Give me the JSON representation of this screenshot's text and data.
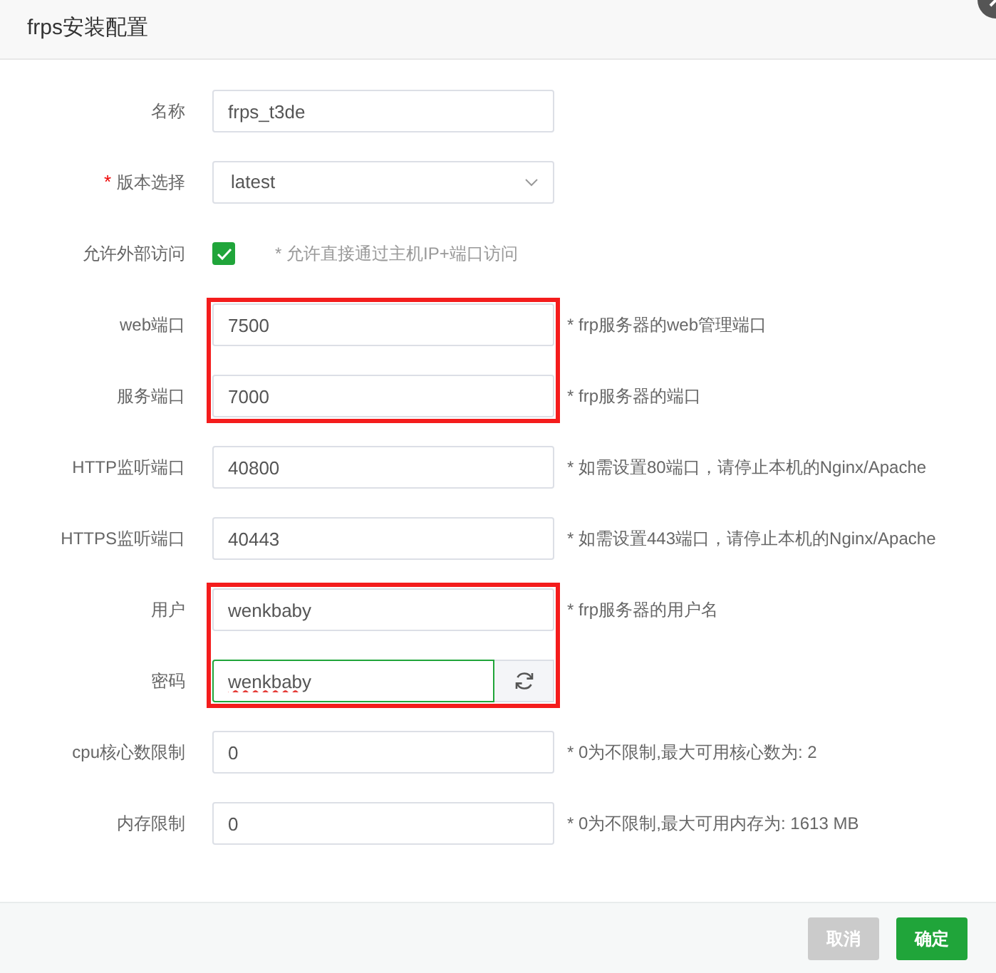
{
  "window": {
    "title": "frps安装配置"
  },
  "groups": [
    {
      "highlighted": false,
      "rows": [
        {
          "kind": "text",
          "label": "名称",
          "value": "frps_t3de"
        },
        {
          "kind": "select",
          "label": "版本选择",
          "required_mark": "*",
          "value": "latest"
        },
        {
          "kind": "checkbox",
          "label": "允许外部访问",
          "checked": true,
          "hint": "* 允许直接通过主机IP+端口访问"
        }
      ]
    },
    {
      "highlighted": true,
      "rows": [
        {
          "kind": "text",
          "label": "web端口",
          "value": "7500",
          "hint": "* frp服务器的web管理端口"
        },
        {
          "kind": "text",
          "label": "服务端口",
          "value": "7000",
          "hint": "* frp服务器的端口"
        }
      ]
    },
    {
      "highlighted": false,
      "rows": [
        {
          "kind": "text",
          "label": "HTTP监听端口",
          "value": "40800",
          "hint": "* 如需设置80端口，请停止本机的Nginx/Apache"
        },
        {
          "kind": "text",
          "label": "HTTPS监听端口",
          "value": "40443",
          "hint": "* 如需设置443端口，请停止本机的Nginx/Apache"
        }
      ]
    },
    {
      "highlighted": true,
      "rows": [
        {
          "kind": "text",
          "label": "用户",
          "value": "wenkbaby",
          "hint": "* frp服务器的用户名"
        },
        {
          "kind": "password",
          "label": "密码",
          "value": "wenkbaby",
          "focused": true
        }
      ]
    },
    {
      "highlighted": false,
      "rows": [
        {
          "kind": "text",
          "label": "cpu核心数限制",
          "value": "0",
          "hint": "* 0为不限制,最大可用核心数为: 2"
        },
        {
          "kind": "text",
          "label": "内存限制",
          "value": "0",
          "hint": "* 0为不限制,最大可用内存为: 1613 MB"
        }
      ]
    }
  ],
  "buttons": [
    {
      "label": "取消",
      "kind": "secondary"
    },
    {
      "label": "确定",
      "kind": "primary"
    }
  ]
}
